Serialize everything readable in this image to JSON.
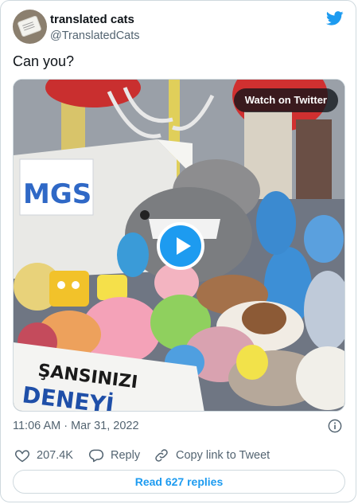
{
  "author": {
    "display_name": "translated cats",
    "handle": "@TranslatedCats",
    "avatar_icon": "avatar-image"
  },
  "brand_icon": "twitter-bird-icon",
  "tweet": {
    "text": "Can you?"
  },
  "media": {
    "watch_label": "Watch on Twitter",
    "sign_text": "MGS",
    "banner_line1": "ŞANSINIZI",
    "banner_line2": "DENEYİ"
  },
  "meta": {
    "timestamp": "11:06 AM · Mar 31, 2022"
  },
  "actions": {
    "likes": "207.4K",
    "reply_label": "Reply",
    "copy_label": "Copy link to Tweet"
  },
  "read_replies_label": "Read 627 replies",
  "colors": {
    "accent": "#1d9bf0",
    "like_icon": "#536471",
    "text_secondary": "#536471",
    "border": "#cfd9de"
  }
}
